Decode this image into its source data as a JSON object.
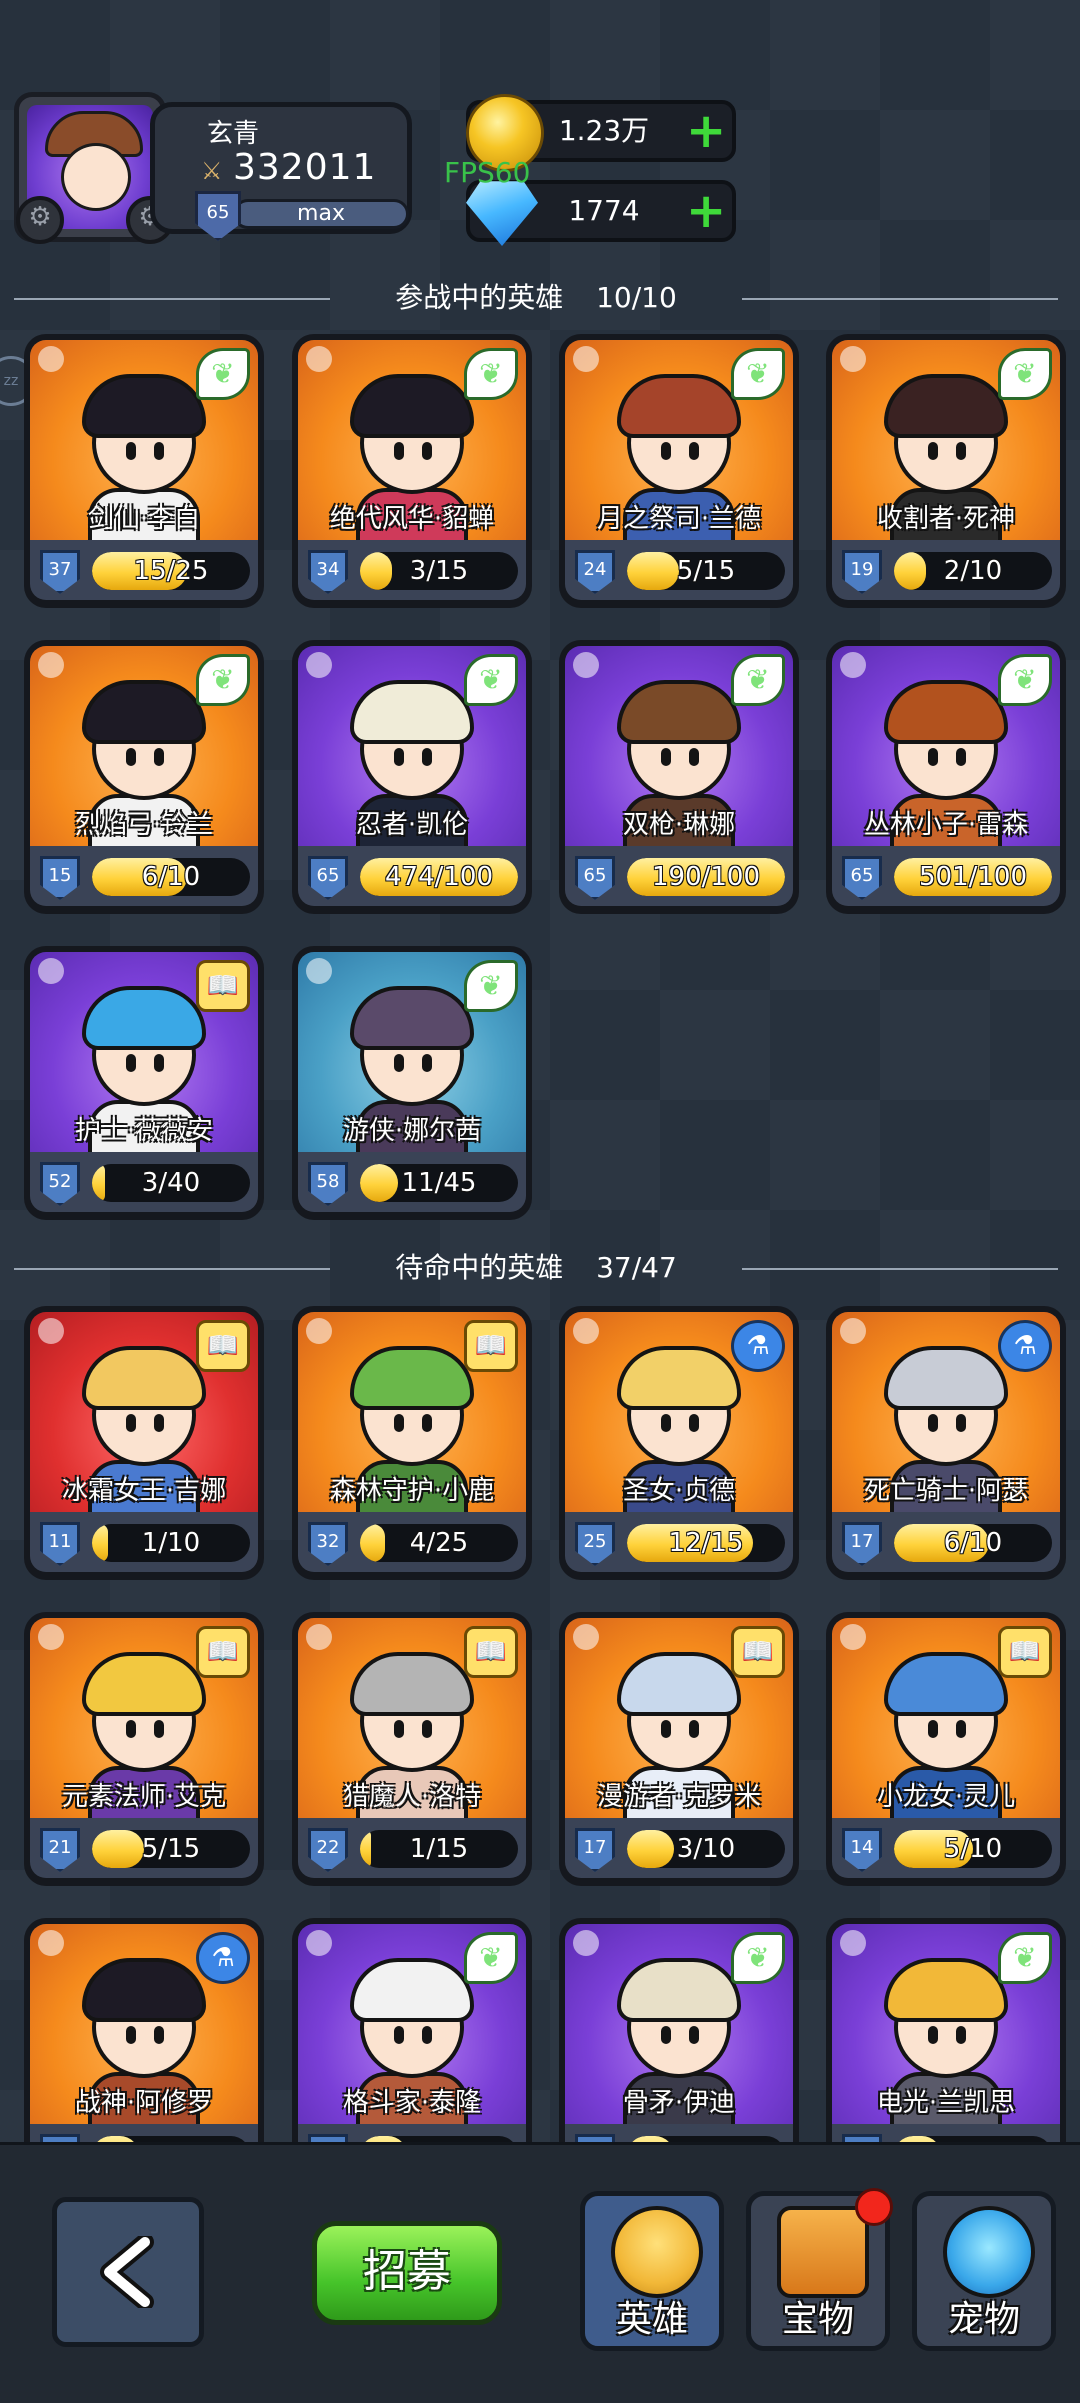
{
  "player": {
    "name": "玄青",
    "power": "332011",
    "level": "65",
    "level_status": "max"
  },
  "currency": {
    "gold": "1.23万",
    "gems": "1774",
    "plus_icon": "+"
  },
  "fps_label": "FPS60",
  "side_bubble": "zz",
  "sections": {
    "active": {
      "title": "参战中的英雄",
      "count": "10/10"
    },
    "standby": {
      "title": "待命中的英雄",
      "count": "37/47"
    }
  },
  "active_heroes": [
    {
      "name": "剑仙·李白",
      "level": "37",
      "progress": "15/25",
      "fill": 0.6,
      "bg": "orange",
      "badge": "leaf",
      "hair": "#1d1a25",
      "body": "#f2f2f2"
    },
    {
      "name": "绝代风华·貂蝉",
      "level": "34",
      "progress": "3/15",
      "fill": 0.2,
      "bg": "orange",
      "badge": "leaf",
      "hair": "#1d1a25",
      "body": "#cf3a5a"
    },
    {
      "name": "月之祭司·兰德",
      "level": "24",
      "progress": "5/15",
      "fill": 0.33,
      "bg": "orange",
      "badge": "leaf",
      "hair": "#a5442a",
      "body": "#3c5fb0"
    },
    {
      "name": "收割者·死神",
      "level": "19",
      "progress": "2/10",
      "fill": 0.2,
      "bg": "orange",
      "badge": "leaf",
      "hair": "#3a2222",
      "body": "#2a2a2a"
    },
    {
      "name": "烈焰弓·铃兰",
      "level": "15",
      "progress": "6/10",
      "fill": 0.6,
      "bg": "orange",
      "badge": "leaf",
      "hair": "#1d1a25",
      "body": "#f2f2f2"
    },
    {
      "name": "忍者·凯伦",
      "level": "65",
      "progress": "474/100",
      "fill": 1.0,
      "bg": "purple",
      "badge": "leaf",
      "hair": "#f0ecd8",
      "body": "#1d2436"
    },
    {
      "name": "双枪·琳娜",
      "level": "65",
      "progress": "190/100",
      "fill": 1.0,
      "bg": "purple",
      "badge": "leaf",
      "hair": "#7a4a28",
      "body": "#5a3a2a"
    },
    {
      "name": "丛林小子·雷森",
      "level": "65",
      "progress": "501/100",
      "fill": 1.0,
      "bg": "purple",
      "badge": "leaf",
      "hair": "#b2521e",
      "body": "#c9642a"
    },
    {
      "name": "护士·薇薇安",
      "level": "52",
      "progress": "3/40",
      "fill": 0.08,
      "bg": "purple",
      "badge": "book",
      "hair": "#3aa8e6",
      "body": "#f2f2f2"
    },
    {
      "name": "游侠·娜尔茜",
      "level": "58",
      "progress": "11/45",
      "fill": 0.24,
      "bg": "teal",
      "badge": "leaf",
      "hair": "#5a4a6a",
      "body": "#4a3a5a"
    }
  ],
  "standby_heroes": [
    {
      "name": "冰霜女王·吉娜",
      "level": "11",
      "progress": "1/10",
      "fill": 0.1,
      "bg": "red",
      "badge": "book",
      "hair": "#f2c860",
      "body": "#4a7ad0"
    },
    {
      "name": "森林守护·小鹿",
      "level": "32",
      "progress": "4/25",
      "fill": 0.16,
      "bg": "orange",
      "badge": "book",
      "hair": "#6ab84a",
      "body": "#4a8a3a"
    },
    {
      "name": "圣女·贞德",
      "level": "25",
      "progress": "12/15",
      "fill": 0.8,
      "bg": "orange",
      "badge": "potion",
      "hair": "#f2d068",
      "body": "#3a4a8a"
    },
    {
      "name": "死亡骑士·阿瑟",
      "level": "17",
      "progress": "6/10",
      "fill": 0.6,
      "bg": "orange",
      "badge": "potion",
      "hair": "#c8ccd6",
      "body": "#4a4a6a"
    },
    {
      "name": "元素法师·艾克",
      "level": "21",
      "progress": "5/15",
      "fill": 0.33,
      "bg": "orange",
      "badge": "book",
      "hair": "#f2c840",
      "body": "#6a3aa8"
    },
    {
      "name": "猎魔人·洛特",
      "level": "22",
      "progress": "1/15",
      "fill": 0.07,
      "bg": "orange",
      "badge": "book",
      "hair": "#b4b4b4",
      "body": "#e8c8b8"
    },
    {
      "name": "漫游者·克罗米",
      "level": "17",
      "progress": "3/10",
      "fill": 0.3,
      "bg": "orange",
      "badge": "book",
      "hair": "#c8d8ec",
      "body": "#e8eef8"
    },
    {
      "name": "小龙女·灵儿",
      "level": "14",
      "progress": "5/10",
      "fill": 0.5,
      "bg": "orange",
      "badge": "book",
      "hair": "#4a8ad8",
      "body": "#2a5aa8"
    },
    {
      "name": "战神·阿修罗",
      "level": "",
      "progress": "",
      "fill": 0.3,
      "bg": "orange",
      "badge": "potion",
      "hair": "#1d1a25",
      "body": "#a84a2a"
    },
    {
      "name": "格斗家·泰隆",
      "level": "",
      "progress": "",
      "fill": 0.3,
      "bg": "purple",
      "badge": "leaf",
      "hair": "#f2f2f2",
      "body": "#b45a3a"
    },
    {
      "name": "骨矛·伊迪",
      "level": "",
      "progress": "",
      "fill": 0.3,
      "bg": "purple",
      "badge": "leaf",
      "hair": "#e8e0c8",
      "body": "#3a3a4a"
    },
    {
      "name": "电光·兰凯思",
      "level": "",
      "progress": "",
      "fill": 0.3,
      "bg": "purple",
      "badge": "leaf",
      "hair": "#f2b838",
      "body": "#5a5a6a"
    }
  ],
  "bottom_nav": {
    "back_icon": "back-chevron-icon",
    "recruit_label": "招募",
    "tabs": [
      {
        "label": "英雄",
        "icon": "hero-tab-icon",
        "active": true
      },
      {
        "label": "宝物",
        "icon": "treasure-tab-icon",
        "notification": true
      },
      {
        "label": "宠物",
        "icon": "pet-tab-icon"
      }
    ]
  },
  "colors": {
    "accent_green": "#46c42a",
    "bar_gold": "#ffd23a",
    "background": "#27313d"
  }
}
